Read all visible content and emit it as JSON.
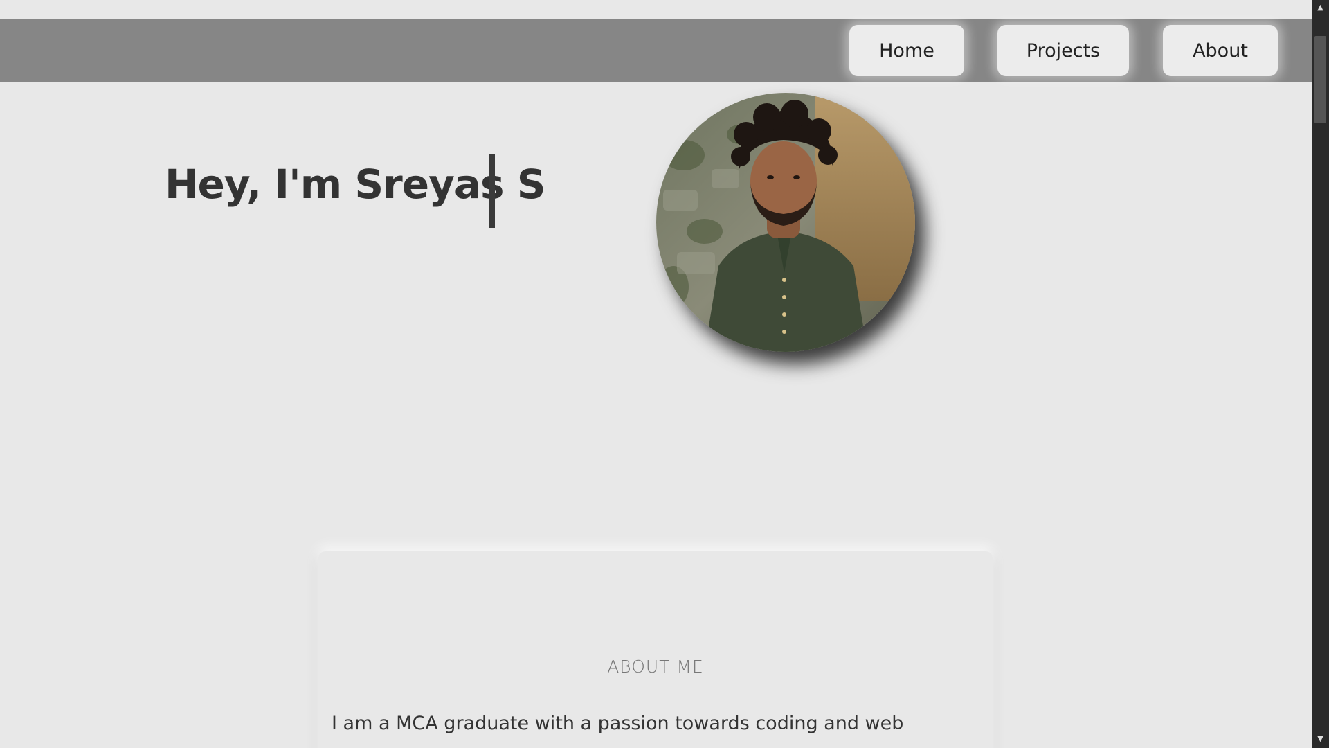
{
  "nav": {
    "home_label": "Home",
    "projects_label": "Projects",
    "about_label": "About"
  },
  "hero": {
    "greeting": "Hey, I'm Sreyas S"
  },
  "about": {
    "title": "ABOUT ME",
    "text": "I am a MCA graduate with a passion towards coding and web"
  },
  "colors": {
    "background": "#e8e8e8",
    "navbar": "#868686",
    "nav_button": "#ececec",
    "text": "#333333"
  }
}
